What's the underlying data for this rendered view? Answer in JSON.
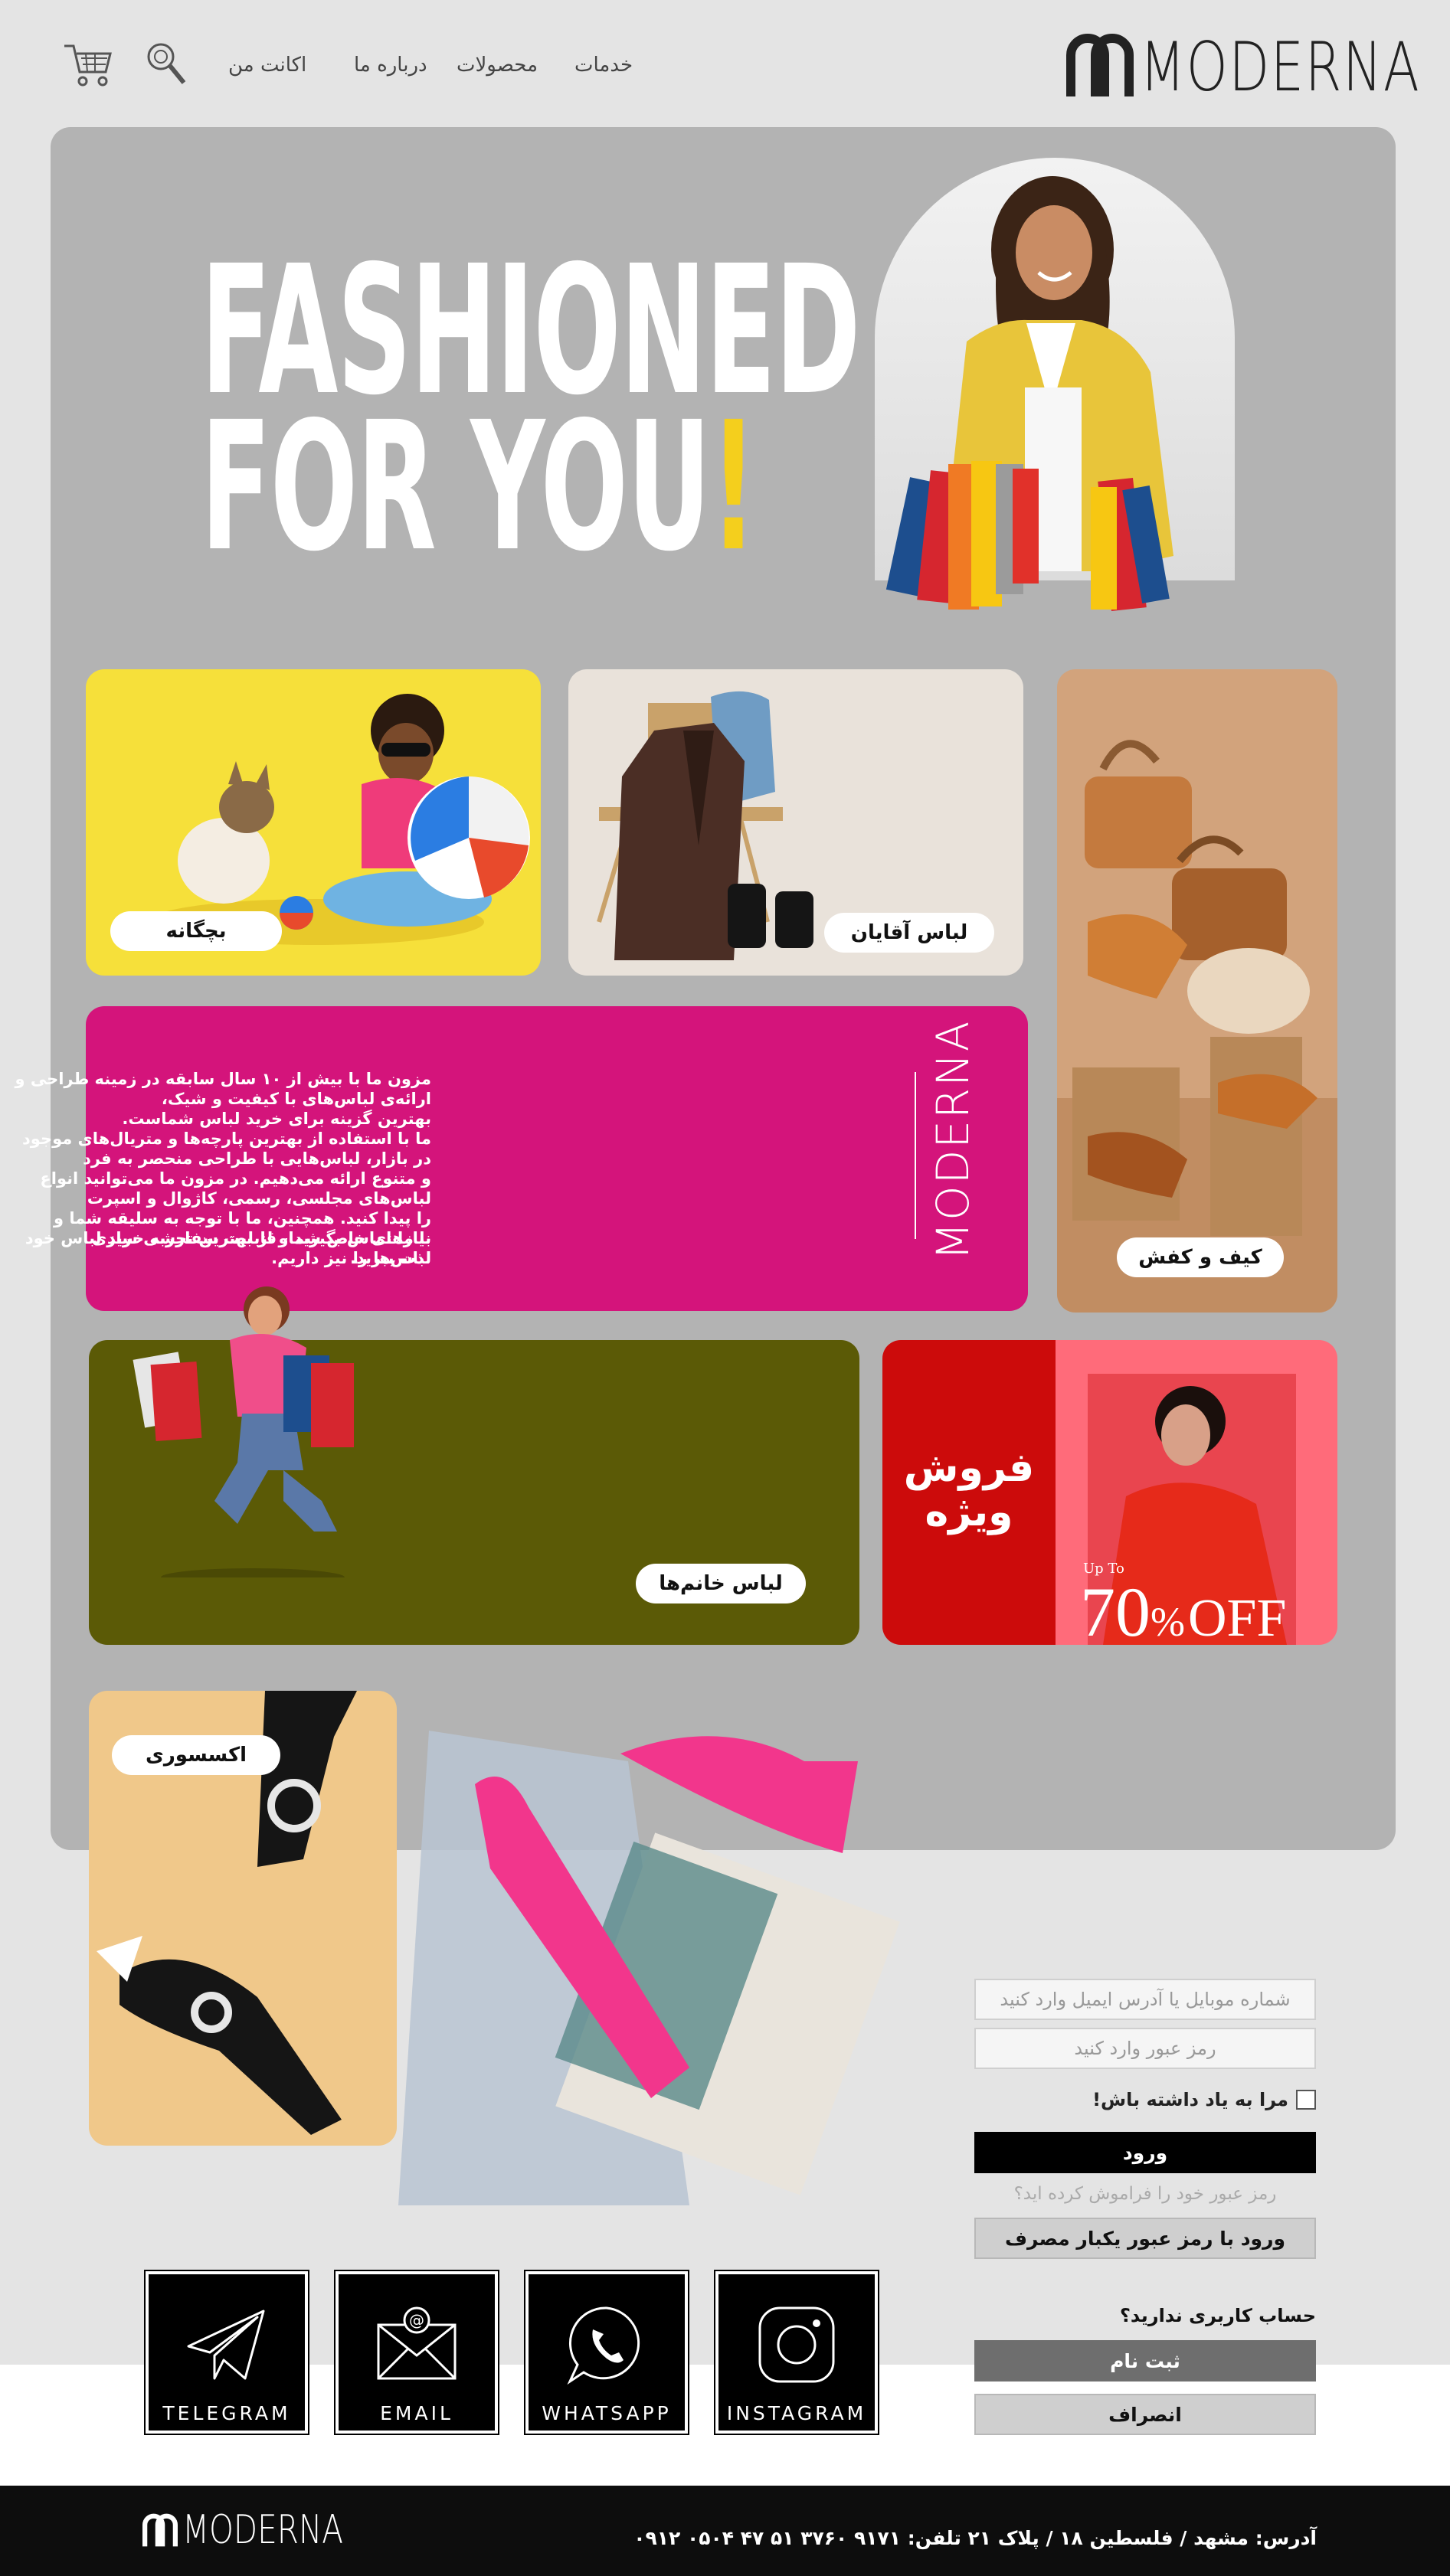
{
  "brand": {
    "name": "MODERNA"
  },
  "nav": {
    "services": "خدمات",
    "products": "محصولات",
    "about": "درباره ما",
    "account": "اکانت من"
  },
  "hero": {
    "headline_line1": "FASHIONED",
    "headline_line2": "FOR YOU",
    "headline_mark": "!"
  },
  "categories": {
    "kids": "بچگانه",
    "men": "لباس آقایان",
    "bags_shoes": "کیف و کفش",
    "women": "لباس خانم‌ها",
    "accessories": "اکسسوری"
  },
  "about": {
    "brand_vertical": "MODERNA",
    "p1": "مزون ما با بیش از ۱۰ سال سابقه در زمینه طراحی و ارائه‌ی لباس‌های با کیفیت و شیک،",
    "p1b": "بهترین گزینه برای خرید لباس شماست.",
    "p2a": "ما با استفاده از بهترین پارچه‌ها و متریال‌های موجود در بازار، لباس‌هایی با طراحی منحصر به فرد",
    "p2b": "و متنوع ارائه می‌دهیم. در مزون ما می‌توانید انواع لباس‌های مجلسی، رسمی، کاژوال و اسپرت",
    "p2c": "را پیدا کنید. همچنین، ما با توجه به سلیقه شما و نیازهای خاص شما، قابلیت سفارشی سازی",
    "p2d": "لباس‌ها را نیز داریم.",
    "p3": "با ما تماس بگیرید و از بهترین تجربه خرید لباس خود لذت ببرید."
  },
  "sale": {
    "title_line1": "فروش",
    "title_line2": "ویژه",
    "up_to": "Up To",
    "percent": "70",
    "pct_sign": "%",
    "off": "OFF"
  },
  "login": {
    "username_placeholder": "شماره موبایل یا آدرس ایمیل وارد کنید",
    "password_placeholder": "رمز عبور وارد کنید",
    "remember": "مرا به یاد داشته باش!",
    "login_button": "ورود",
    "forgot": "رمز عبور خود را فراموش کرده اید؟",
    "otp_button": "ورود با رمز عبور یکبار مصرف",
    "no_account": "حساب کاربری ندارید؟",
    "register_button": "ثبت نام",
    "cancel_button": "انصراف"
  },
  "social": {
    "telegram": "TELEGRAM",
    "email": "EMAIL",
    "whatsapp": "WHATSAPP",
    "instagram": "INSTAGRAM"
  },
  "footer": {
    "address": "آدرس: مشهد  /  فلسطین ۱۸  /  پلاک ۲۱       تلفن:  ۹۱۷۱  ۳۷۶۰  ۵۱    ۴۷  ۰۵۰۴  ۰۹۱۲"
  },
  "colors": {
    "hero_gray": "#b3b3b3",
    "kids_yellow": "#f6e03a",
    "about_magenta": "#d4147b",
    "women_olive": "#5b5a06",
    "sale_red": "#cc0b0b",
    "accent_yellow": "#f4cf1d"
  }
}
